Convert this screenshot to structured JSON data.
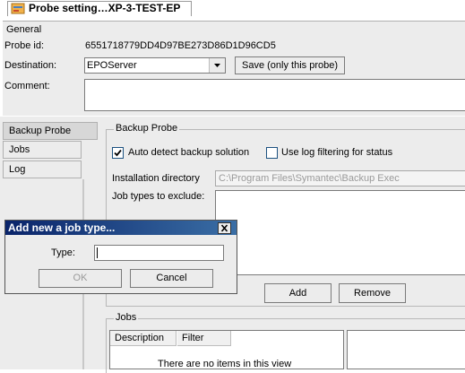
{
  "window": {
    "title": "Probe setting…XP-3-TEST-EP",
    "icon": "probe-settings-icon"
  },
  "general": {
    "legend": "General",
    "probe_id_label": "Probe id:",
    "probe_id_value": "6551718779DD4D97BE273D86D1D96CD5",
    "destination_label": "Destination:",
    "destination_value": "EPOServer",
    "save_button": "Save (only this probe)",
    "comment_label": "Comment:",
    "comment_value": ""
  },
  "tabs": [
    {
      "label": "Backup Probe",
      "selected": true
    },
    {
      "label": "Jobs",
      "selected": false
    },
    {
      "label": "Log",
      "selected": false
    }
  ],
  "backup_probe": {
    "legend": "Backup Probe",
    "auto_detect_label": "Auto detect backup solution",
    "auto_detect_checked": true,
    "log_filter_label": "Use log filtering for status",
    "log_filter_checked": false,
    "install_dir_label": "Installation directory",
    "install_dir_value": "C:\\Program Files\\Symantec\\Backup Exec",
    "exclude_label": "Job types to exclude:",
    "add_button": "Add",
    "remove_button": "Remove"
  },
  "jobs": {
    "legend": "Jobs",
    "columns": [
      "Description",
      "Filter"
    ],
    "empty_text": "There are no items in this view"
  },
  "dialog": {
    "title": "Add new a job type...",
    "type_label": "Type:",
    "type_value": "",
    "ok_button": "OK",
    "cancel_button": "Cancel"
  },
  "colors": {
    "dialog_title_start": "#0a246a",
    "dialog_title_end": "#3a6ea5",
    "panel_bg": "#ececec"
  }
}
